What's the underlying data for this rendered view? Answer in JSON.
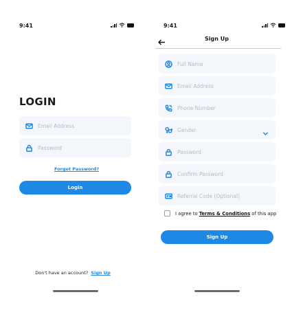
{
  "login": {
    "status_time": "9:41",
    "title": "LOGIN",
    "email_placeholder": "Email Address",
    "password_placeholder": "Password",
    "forget_password": "Forget Password?",
    "login_button": "Login",
    "footer_text": "Don't have an account?",
    "footer_link": "Sign Up"
  },
  "signup": {
    "status_time": "9:41",
    "title": "Sign Up",
    "fields": {
      "full_name": "Full Name",
      "email": "Email Address",
      "phone": "Phone Number",
      "gender": "Gender",
      "password": "Password",
      "confirm_password": "Confirm Password",
      "referral": "Referral Code (Optional)"
    },
    "agree_prefix": "I agree to ",
    "agree_terms": "Terms & Conditions",
    "agree_suffix": " of this app",
    "signup_button": "Sign Up"
  },
  "colors": {
    "accent": "#1e88e5",
    "field_bg": "#f3f6fb",
    "placeholder": "#b7bcc7"
  },
  "icons": [
    "back-arrow-icon",
    "mail-icon",
    "lock-icon",
    "user-icon",
    "phone-icon",
    "gender-icon",
    "chevron-down-icon",
    "card-icon",
    "signal-icon",
    "wifi-icon",
    "battery-icon"
  ]
}
